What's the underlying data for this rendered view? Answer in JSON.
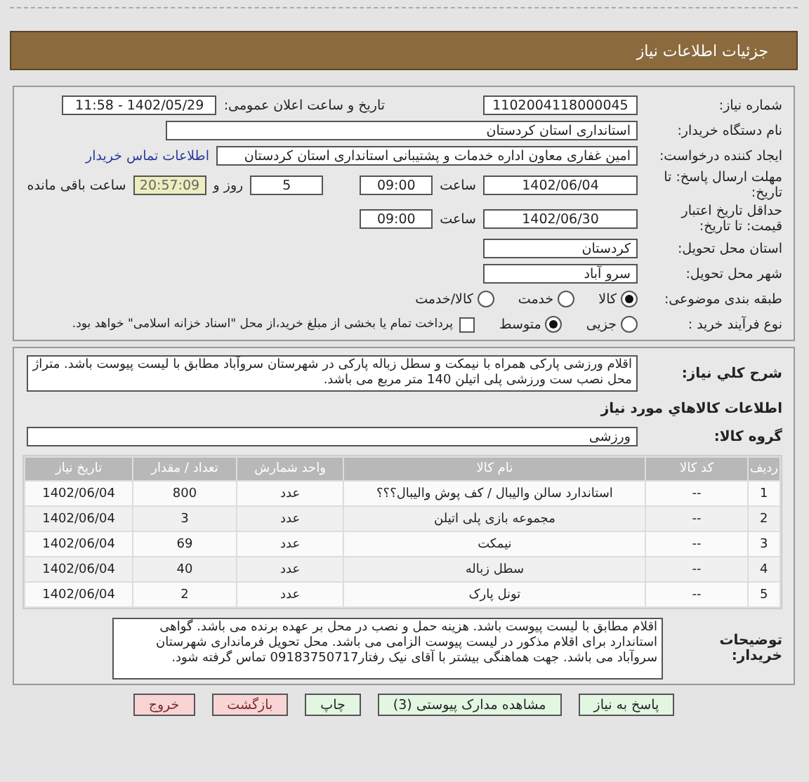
{
  "header": {
    "title": "جزئیات اطلاعات نیاز"
  },
  "info": {
    "need_number": {
      "label": "شماره نیاز:",
      "value": "1102004118000045"
    },
    "announce": {
      "label": "تاریخ و ساعت اعلان عمومی:",
      "value": "1402/05/29 - 11:58"
    },
    "buyer_org": {
      "label": "نام دستگاه خریدار:",
      "value": "استانداری استان کردستان"
    },
    "creator": {
      "label": "ایجاد کننده درخواست:",
      "value": "امین غفاری معاون اداره خدمات و پشتیبانی استانداری استان کردستان",
      "link": "اطلاعات تماس خریدار"
    },
    "deadline": {
      "label": "مهلت ارسال پاسخ: تا تاریخ:",
      "date": "1402/06/04",
      "time_label": "ساعت",
      "time": "09:00",
      "days": "5",
      "days_label": "روز و",
      "remaining": "20:57:09",
      "remaining_label": "ساعت باقی مانده"
    },
    "validity": {
      "label": "حداقل تاریخ اعتبار قیمت: تا تاریخ:",
      "date": "1402/06/30",
      "time_label": "ساعت",
      "time": "09:00"
    },
    "province": {
      "label": "استان محل تحویل:",
      "value": "کردستان"
    },
    "city": {
      "label": "شهر محل تحویل:",
      "value": "سرو آباد"
    },
    "category": {
      "label": "طبقه بندی موضوعی:",
      "options": [
        {
          "label": "کالا",
          "selected": true
        },
        {
          "label": "خدمت",
          "selected": false
        },
        {
          "label": "کالا/خدمت",
          "selected": false
        }
      ]
    },
    "process": {
      "label": "نوع فرآیند خرید :",
      "options": [
        {
          "label": "جزیی",
          "selected": false
        },
        {
          "label": "متوسط",
          "selected": true
        }
      ],
      "payment": {
        "label": "پرداخت تمام یا بخشی از مبلغ خرید،از محل \"اسناد خزانه اسلامی\" خواهد بود.",
        "checked": false
      }
    }
  },
  "summary": {
    "label": "شرح کلي نياز:",
    "text": "اقلام ورزشی پارکی همراه با نیمکت و سطل زباله پارکی در شهرستان سروآباد مطابق با لیست پیوست باشد. متراژ محل نصب ست ورزشی پلی اتیلن 140 متر مربع می باشد."
  },
  "goods_title": "اطلاعات کالاهاي مورد نياز",
  "group": {
    "label": "گروه کالا:",
    "value": "ورزشی"
  },
  "table": {
    "columns": [
      "ردیف",
      "کد کالا",
      "نام کالا",
      "واحد شمارش",
      "تعداد / مقدار",
      "تاریخ نیاز"
    ],
    "rows": [
      [
        "1",
        "--",
        "استاندارد سالن والیبال / کف پوش والیبال؟؟؟",
        "عدد",
        "800",
        "1402/06/04"
      ],
      [
        "2",
        "--",
        "مجموعه بازی پلی اتیلن",
        "عدد",
        "3",
        "1402/06/04"
      ],
      [
        "3",
        "--",
        "نیمکت",
        "عدد",
        "69",
        "1402/06/04"
      ],
      [
        "4",
        "--",
        "سطل زباله",
        "عدد",
        "40",
        "1402/06/04"
      ],
      [
        "5",
        "--",
        "تونل پارک",
        "عدد",
        "2",
        "1402/06/04"
      ]
    ]
  },
  "notes": {
    "label": "توضیحات خریدار:",
    "text": "اقلام مطابق با لیست پیوست باشد. هزینه حمل و نصب در محل بر عهده برنده می باشد. گواهی استاندارد برای اقلام مذکور در لیست پیوست الزامی می باشد. محل تحویل فرمانداری شهرستان سروآباد می باشد. جهت هماهنگی بیشتر با آقای نیک رفتار09183750717 تماس گرفته شود."
  },
  "buttons": [
    {
      "label": "پاسخ به نياز",
      "kind": "action"
    },
    {
      "label": "مشاهده مدارک پیوستی (3)",
      "kind": "action"
    },
    {
      "label": "چاپ",
      "kind": "action"
    },
    {
      "label": "بازگشت",
      "kind": "danger"
    },
    {
      "label": "خروج",
      "kind": "danger"
    }
  ]
}
